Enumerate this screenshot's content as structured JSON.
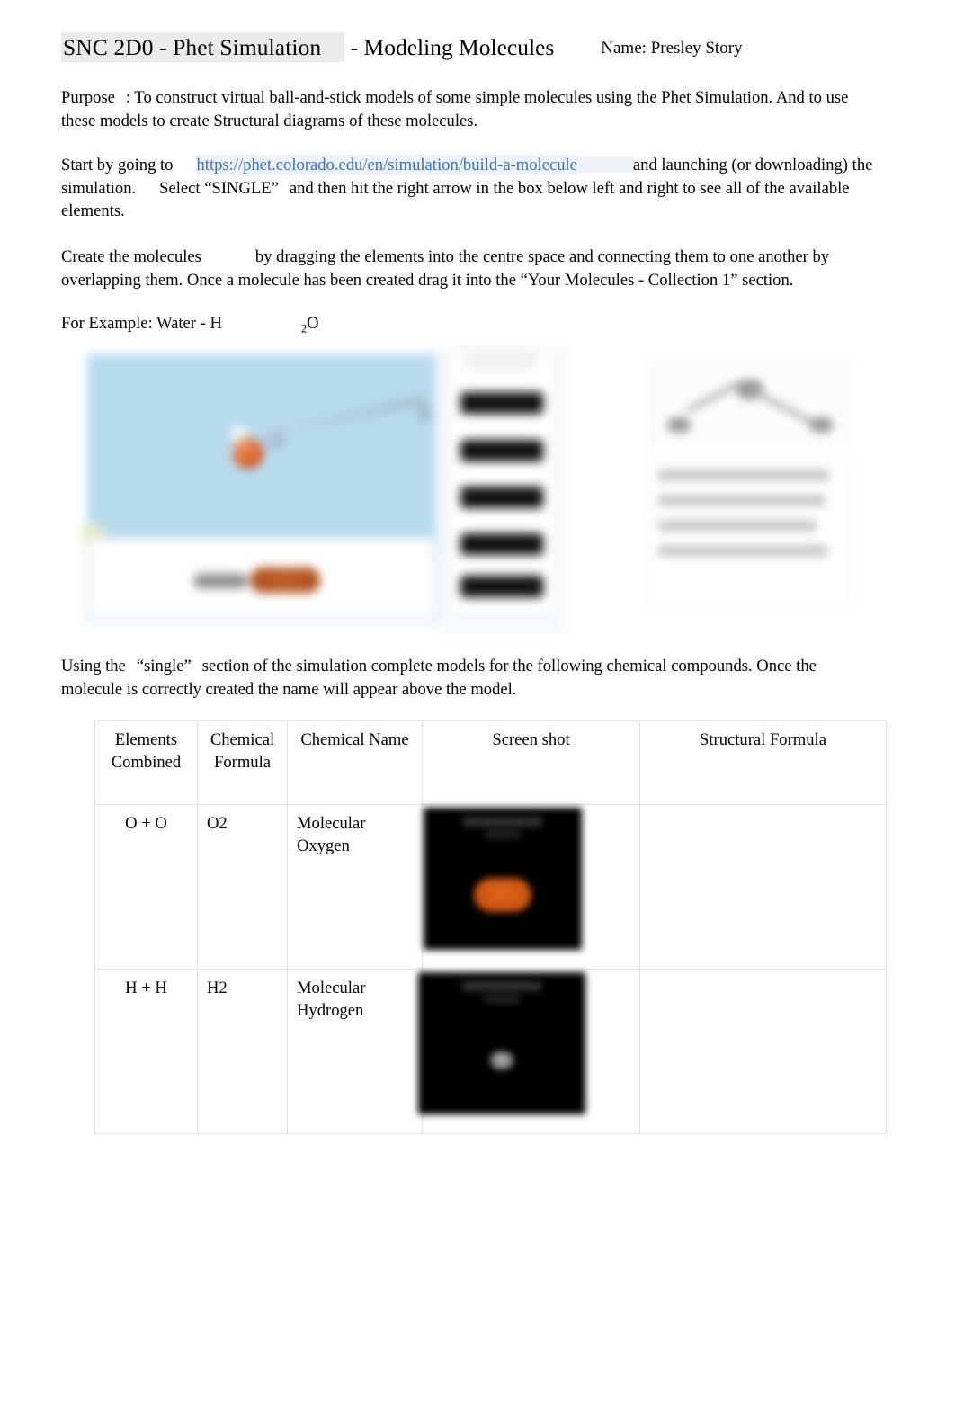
{
  "document": {
    "title_highlighted": "SNC 2D0 - Phet Simulation",
    "title_rest": "- Modeling Molecules",
    "name_label": "Name: Presley Story"
  },
  "purpose": {
    "label": "Purpose",
    "colon": ":",
    "text": "To construct virtual ball-and-stick models of some simple molecules using the Phet Simulation. And to use these models to create Structural diagrams of these molecules."
  },
  "start": {
    "lead": "Start by going to",
    "link_text": "https://phet.colorado.edu/en/simulation/build-a-molecule",
    "after_link": "and launching (or downloading) the simulation.",
    "select_text": "Select “SINGLE”",
    "tail": "and then hit the right arrow in the box below left and right to see all of the available elements."
  },
  "create": {
    "lead": "Create the molecules",
    "text": "by dragging the elements into the centre space and connecting them to one another by overlapping them. Once a molecule has been created drag it into the “Your Molecules - Collection 1” section."
  },
  "example": {
    "label": "For Example: Water - H",
    "subscript": "2",
    "element": "O"
  },
  "instructions": {
    "lead": "Using the",
    "quoted": "“single”",
    "text": "section of the simulation complete models for the following chemical compounds. Once the molecule is correctly created the name will appear above the model."
  },
  "table": {
    "headers": [
      "Elements Combined",
      "Chemical Formula",
      "Chemical Name",
      "Screen shot",
      "Structural Formula"
    ],
    "rows": [
      {
        "elements_combined": "O + O",
        "chemical_formula": "O2",
        "chemical_name": "Molecular Oxygen",
        "screen_shot": "o2-molecule-screenshot",
        "structural_formula": ""
      },
      {
        "elements_combined": "H + H",
        "chemical_formula": "H2",
        "chemical_name": "Molecular Hydrogen",
        "screen_shot": "h2-molecule-screenshot",
        "structural_formula": ""
      }
    ]
  },
  "colors": {
    "link": "#3b6fd4",
    "link_highlight": "#eef1f5",
    "title_highlight": "#ebebeb",
    "table_border": "#e2e2e2",
    "oxygen_atom": "#c04d10",
    "hydrogen_atom": "#9e9e9e",
    "sim_background": "#b9dbee"
  }
}
